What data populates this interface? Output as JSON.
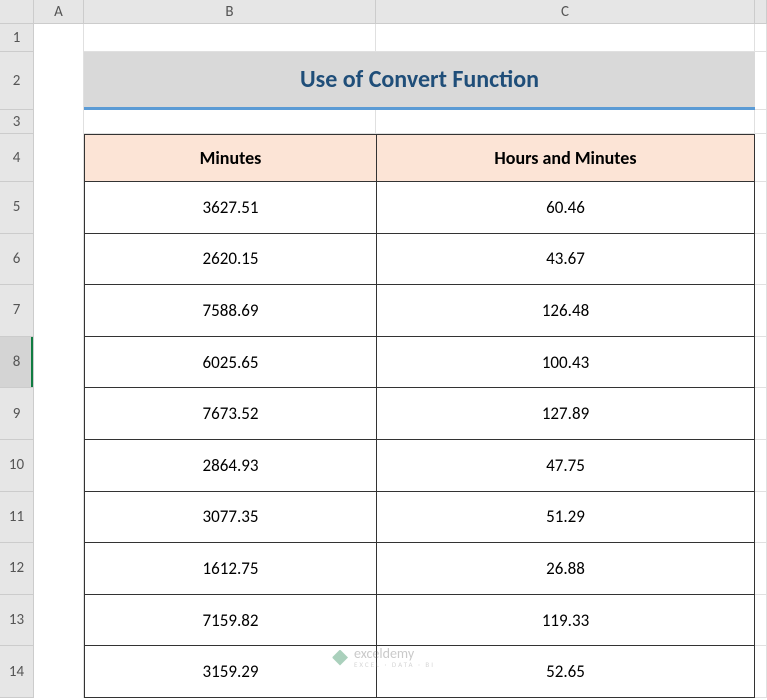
{
  "columns": [
    "A",
    "B",
    "C"
  ],
  "row_numbers": [
    "1",
    "2",
    "3",
    "4",
    "5",
    "6",
    "7",
    "8",
    "9",
    "10",
    "11",
    "12",
    "13",
    "14"
  ],
  "active_row": "8",
  "title": "Use of Convert Function",
  "headers": {
    "col1": "Minutes",
    "col2": "Hours and Minutes"
  },
  "chart_data": {
    "type": "table",
    "columns": [
      "Minutes",
      "Hours and Minutes"
    ],
    "rows": [
      {
        "minutes": "3627.51",
        "hours": "60.46"
      },
      {
        "minutes": "2620.15",
        "hours": "43.67"
      },
      {
        "minutes": "7588.69",
        "hours": "126.48"
      },
      {
        "minutes": "6025.65",
        "hours": "100.43"
      },
      {
        "minutes": "7673.52",
        "hours": "127.89"
      },
      {
        "minutes": "2864.93",
        "hours": "47.75"
      },
      {
        "minutes": "3077.35",
        "hours": "51.29"
      },
      {
        "minutes": "1612.75",
        "hours": "26.88"
      },
      {
        "minutes": "7159.82",
        "hours": "119.33"
      },
      {
        "minutes": "3159.29",
        "hours": "52.65"
      }
    ]
  },
  "watermark": {
    "name": "exceldemy",
    "tagline": "EXCEL · DATA · BI"
  }
}
